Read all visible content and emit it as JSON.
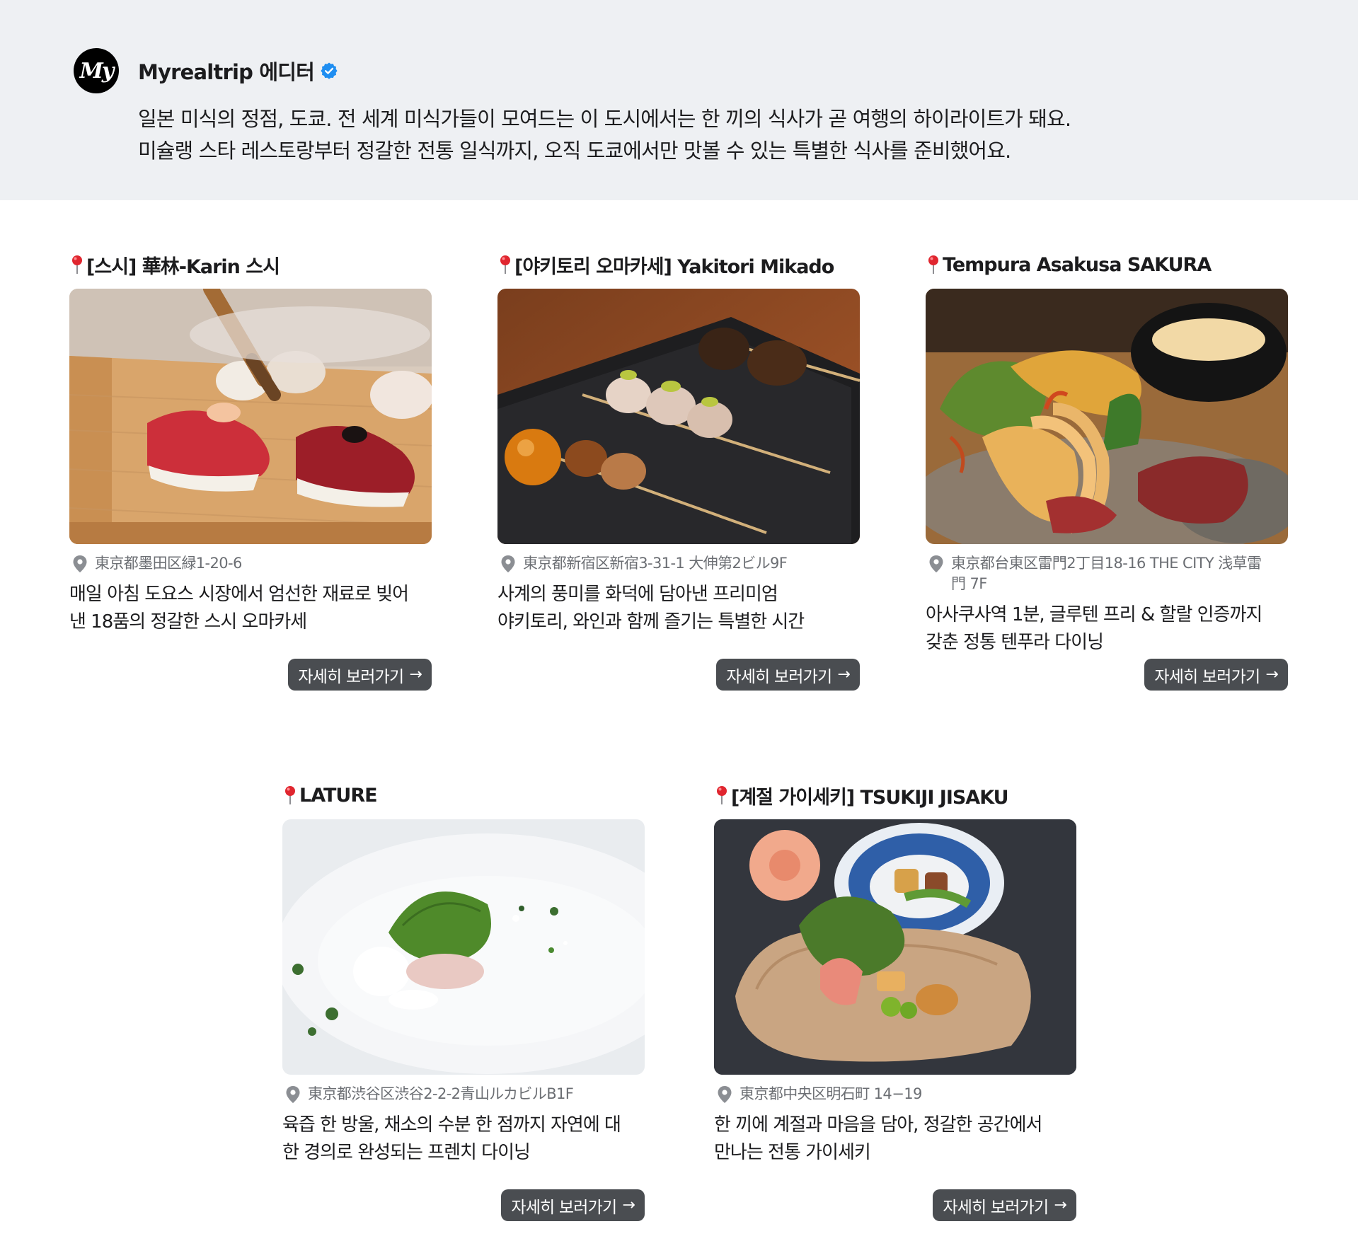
{
  "author": {
    "avatar_text": "My",
    "name": "Myrealtrip 에디터",
    "verified_icon": "verified-badge-icon",
    "accent": "#1f8ef1"
  },
  "intro": {
    "line1": "일본 미식의 정점, 도쿄. 전 세계 미식가들이 모여드는 이 도시에서는 한 끼의 식사가 곧 여행의 하이라이트가 돼요.",
    "line2": "미슐랭 스타 레스토랑부터 정갈한 전통 일식까지, 오직 도쿄에서만 맛볼 수 있는 특별한 식사를 준비했어요."
  },
  "restaurants": [
    {
      "title": "[스시] 華林-Karin 스시",
      "photo": "sushi-photo",
      "address": "東京都墨田区緑1-20-6",
      "desc_line1": "매일 아침 도요스 시장에서 엄선한 재료로 빚어",
      "desc_line2": "낸 18품의 정갈한 스시 오마카세",
      "button": "자세히 보러가기",
      "button_icon": "→"
    },
    {
      "title": "[야키토리 오마카세] Yakitori Mikado",
      "photo": "yakitori-photo",
      "address": "東京都新宿区新宿3-31-1 大伸第2ビル9F",
      "desc_line1": "사계의 풍미를 화덕에 담아낸 프리미엄",
      "desc_line2": "야키토리, 와인과 함께 즐기는 특별한 시간",
      "button": "자세히 보러가기",
      "button_icon": "→"
    },
    {
      "title": "Tempura Asakusa SAKURA",
      "photo": "tempura-photo",
      "address": "東京都台東区雷門2丁目18-16 THE CITY 浅草雷門 7F",
      "desc_line1": "아사쿠사역 1분, 글루텐 프리 & 할랄 인증까지",
      "desc_line2": "갖춘 정통 텐푸라 다이닝",
      "button": "자세히 보러가기",
      "button_icon": "→"
    },
    {
      "title": "LATURE",
      "photo": "french-dish-photo",
      "address": "東京都渋谷区渋谷2-2-2青山ルカビルB1F",
      "desc_line1": "육즙 한 방울, 채소의 수분 한 점까지 자연에 대",
      "desc_line2": "한 경의로 완성되는 프렌치 다이닝",
      "button": "자세히 보러가기",
      "button_icon": "→"
    },
    {
      "title": "[계절 가이세키] TSUKIJI JISAKU",
      "photo": "kaiseki-photo",
      "address": "東京都中央区明石町 14−19",
      "desc_line1": "한 끼에 계절과 마음을 담아, 정갈한 공간에서",
      "desc_line2": "만나는 전통 가이세키",
      "button": "자세히 보러가기",
      "button_icon": "→"
    }
  ]
}
